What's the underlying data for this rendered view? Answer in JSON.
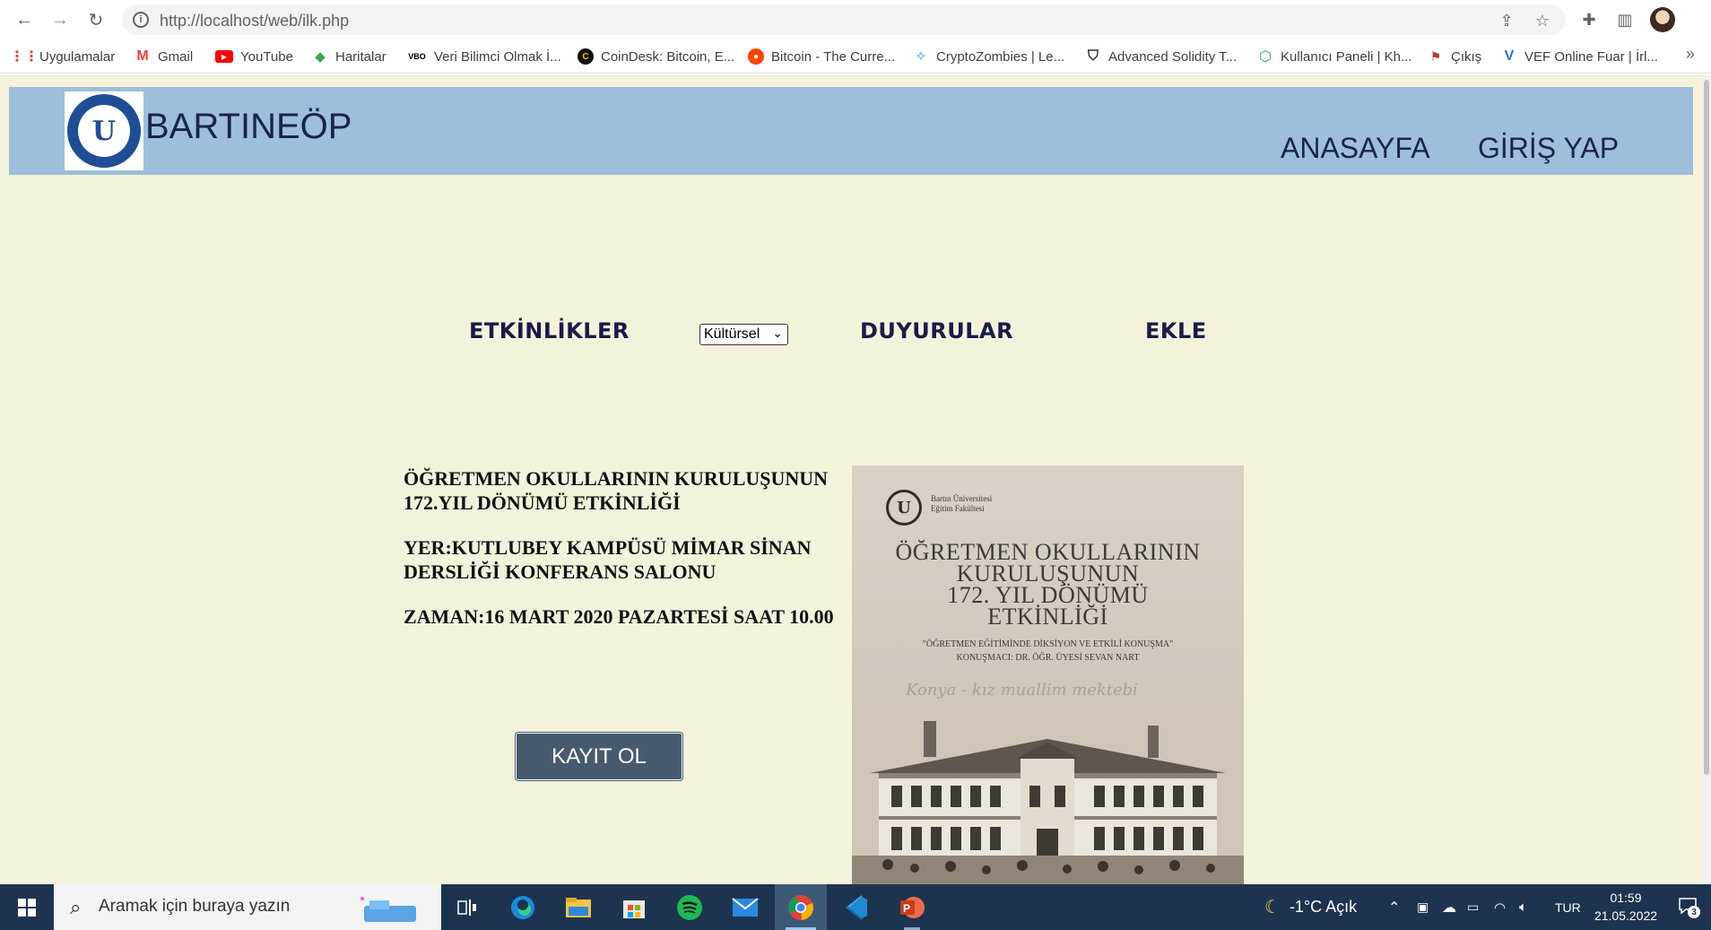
{
  "browser": {
    "url": "http://localhost/web/ilk.php",
    "bookmarks": [
      {
        "label": "Uygulamalar",
        "icon": "apps-grid-icon"
      },
      {
        "label": "Gmail",
        "icon": "gmail-icon"
      },
      {
        "label": "YouTube",
        "icon": "youtube-icon"
      },
      {
        "label": "Haritalar",
        "icon": "maps-icon"
      },
      {
        "label": "Veri Bilimci Olmak İ...",
        "icon": "vbo-icon"
      },
      {
        "label": "CoinDesk: Bitcoin, E...",
        "icon": "coindesk-icon"
      },
      {
        "label": "Bitcoin - The Curre...",
        "icon": "reddit-icon"
      },
      {
        "label": "CryptoZombies | Le...",
        "icon": "cryptozombies-icon"
      },
      {
        "label": "Advanced Solidity T...",
        "icon": "shield-icon"
      },
      {
        "label": "Kullanıcı Paneli | Kh...",
        "icon": "hex-icon"
      },
      {
        "label": "Çıkış",
        "icon": "logout-icon"
      },
      {
        "label": "VEF Online Fuar | İrl...",
        "icon": "vef-icon"
      }
    ]
  },
  "site": {
    "brand": "BARTINEÖP",
    "nav": {
      "home": "ANASAYFA",
      "login": "GİRİŞ YAP"
    },
    "subnav": {
      "events": "ETKİNLİKLER",
      "announcements": "DUYURULAR",
      "add": "EKLE"
    },
    "category_select": {
      "selected": "Kültürsel"
    },
    "event": {
      "title": "ÖĞRETMEN OKULLARININ KURULUŞUNUN 172.YIL DÖNÜMÜ ETKİNLİĞİ",
      "place": "YER:KUTLUBEY KAMPÜSÜ MİMAR SİNAN DERSLİĞİ KONFERANS SALONU",
      "time": "ZAMAN:16 MART 2020 PAZARTESİ SAAT 10.00",
      "register_label": "KAYIT OL"
    },
    "poster": {
      "org_line1": "Bartın Üniversitesi",
      "org_line2": "Eğitim Fakültesi",
      "title_l1": "ÖĞRETMEN OKULLARININ",
      "title_l2": "KURULUŞUNUN",
      "title_l3": "172. YIL DÖNÜMÜ",
      "title_l4": "ETKİNLİĞİ",
      "subtitle": "\"ÖĞRETMEN EĞİTİMİNDE DİKSİYON VE ETKİLİ KONUŞMA\"",
      "speaker": "KONUŞMACI: DR. ÖĞR. ÜYESİ SEVAN NART",
      "script": "Konya - kız muallim mektebi"
    }
  },
  "taskbar": {
    "search_placeholder": "Aramak için buraya yazın",
    "weather": "-1°C  Açık",
    "language": "TUR",
    "time": "01:59",
    "date": "21.05.2022",
    "notifications": "3"
  }
}
